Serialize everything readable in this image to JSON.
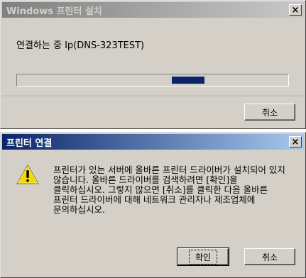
{
  "dialog1": {
    "title": "Windows 프린터 설치",
    "close_glyph": "×",
    "status": "연결하는 중 Ip(DNS-323TEST)",
    "progress": {
      "chunk_start": 0.57,
      "chunk_width": 0.12
    },
    "cancel_label": "취소"
  },
  "dialog2": {
    "title": "프린터 연결",
    "close_glyph": "×",
    "icon": "warning-icon",
    "message": "프린터가 있는 서버에 올바른 프린터 드라이버가 설치되어 있지 않습니다. 올바른 드라이버를 검색하려면 [확인]을 클릭하십시오. 그렇지 않으면 [취소]를 클릭한 다음 올바른 프린터 드라이버에 대해 네트워크 관리자나 제조업체에 문의하십시오.",
    "ok_label": "확인",
    "cancel_label": "취소"
  },
  "colors": {
    "active_title": "#0a246a",
    "inactive_title": "#808080",
    "face": "#d4d0c8",
    "warning": "#f5d800"
  }
}
